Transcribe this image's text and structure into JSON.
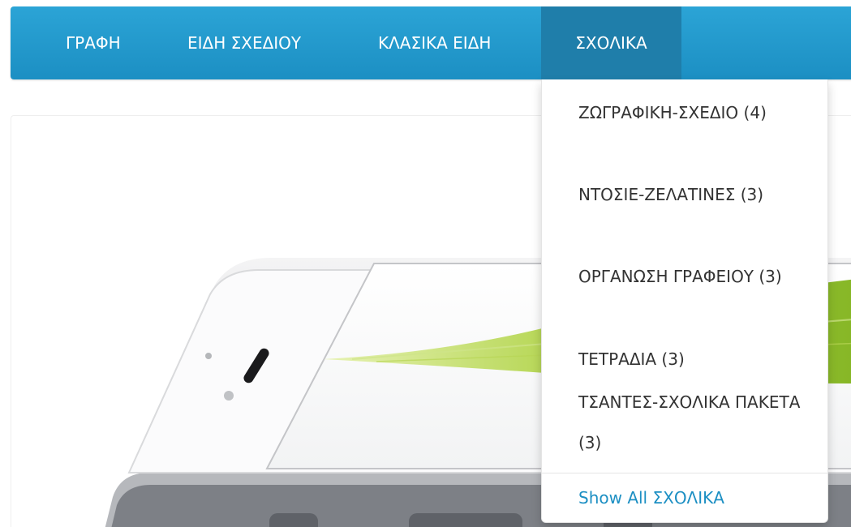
{
  "navbar": {
    "items": [
      {
        "label": "ΓΡΑΦΗ"
      },
      {
        "label": "ΕΙΔΗ ΣΧΕΔΙΟΥ"
      },
      {
        "label": "ΚΛΑΣΙΚΑ ΕΙΔΗ"
      },
      {
        "label": "ΣΧΟΛΙΚΑ",
        "active": true
      }
    ]
  },
  "dropdown": {
    "items": [
      {
        "label": "ΖΩΓΡΑΦΙΚΗ-ΣΧΕΔΙΟ (4)"
      },
      {
        "label": "ΝΤΟΣΙΕ-ΖΕΛΑΤΙΝΕΣ (3)"
      },
      {
        "label": "ΟΡΓΑΝΩΣΗ ΓΡΑΦΕΙΟΥ (3)"
      },
      {
        "label": "ΤΕΤΡΑΔΙΑ (3)"
      },
      {
        "label": "ΤΣΑΝΤΕΣ-ΣΧΟΛΙΚΑ ΠΑΚΕΤΑ (3)"
      }
    ],
    "show_all": "Show All ΣΧΟΛΙΚΑ"
  },
  "colors": {
    "navbar": "#1e96cb",
    "active_tab": "#1f7eaa",
    "link": "#1c8fc3"
  }
}
